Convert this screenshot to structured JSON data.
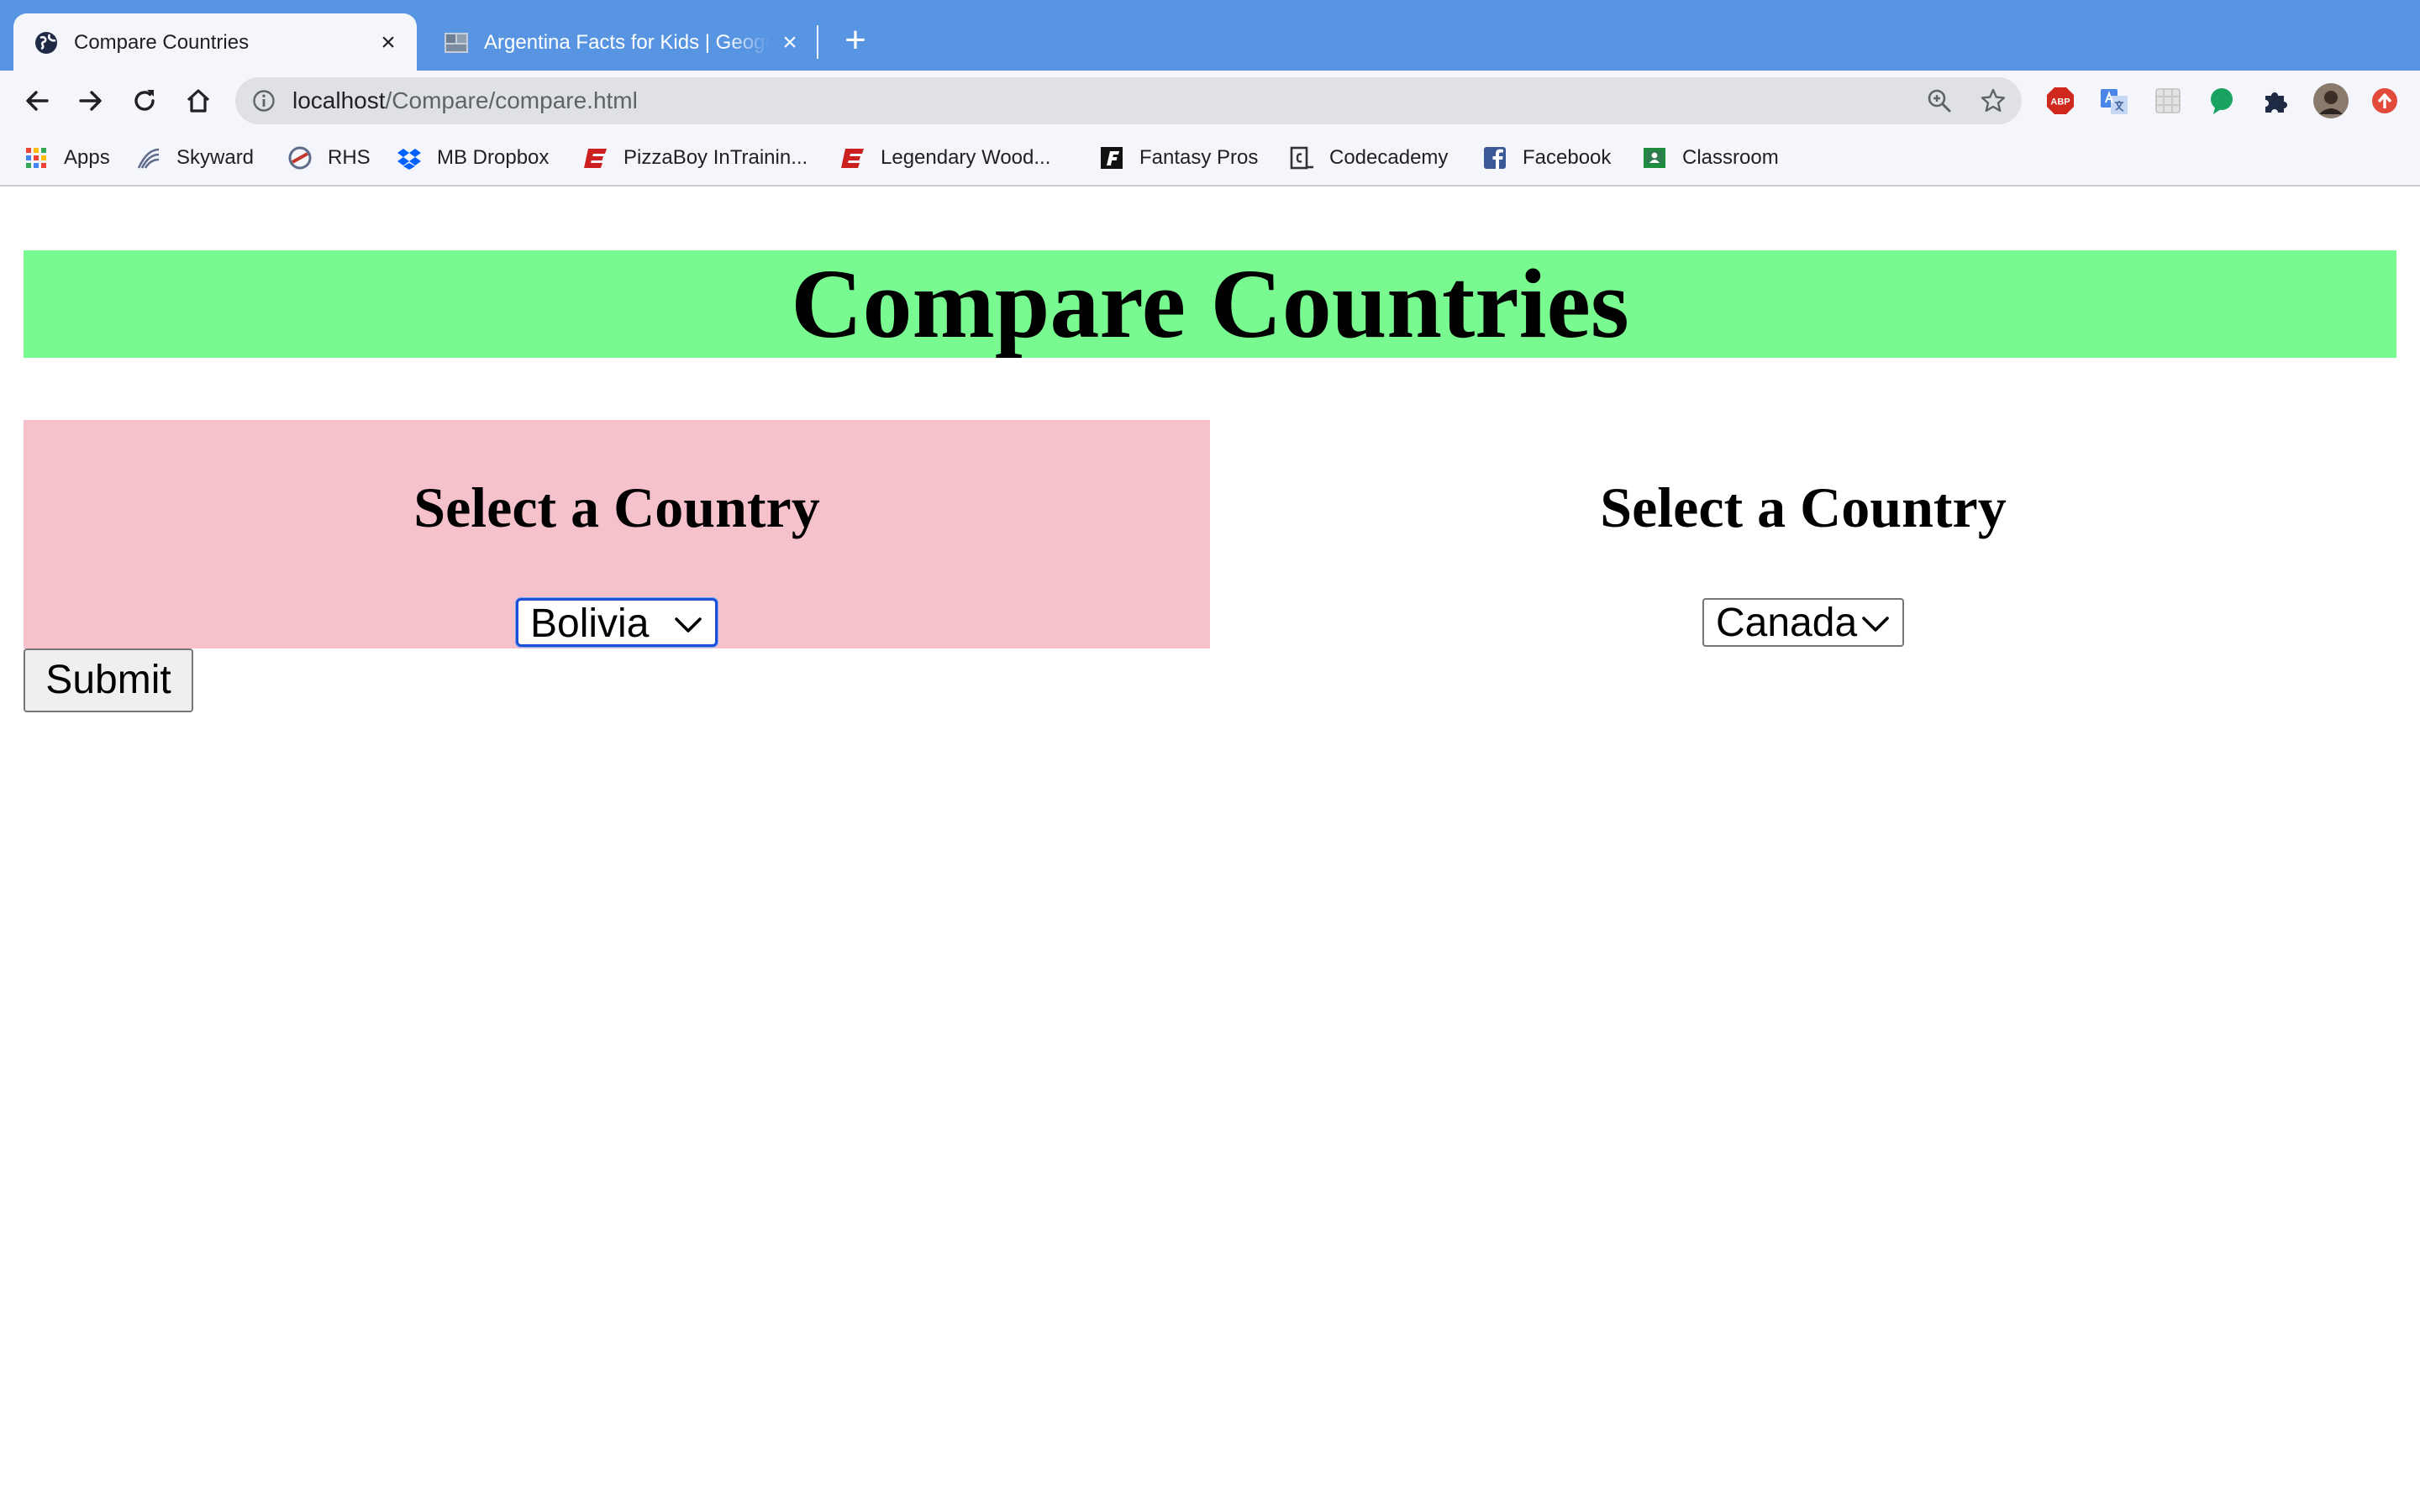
{
  "browser": {
    "tabs": [
      {
        "title": "Compare Countries",
        "icon": "globe-icon",
        "active": true
      },
      {
        "title": "Argentina Facts for Kids | Geography",
        "icon": "page-thumbnail-icon",
        "active": false
      }
    ],
    "close_glyph": "×",
    "new_tab_glyph": "+",
    "address": {
      "host": "localhost",
      "path": "/Compare/compare.html"
    },
    "bookmarks": [
      {
        "label": "Apps",
        "icon": "apps-grid-icon",
        "color": "#ea4335"
      },
      {
        "label": "Skyward",
        "icon": "skyward-icon",
        "color": "#5f6b8a"
      },
      {
        "label": "RHS",
        "icon": "rhs-icon",
        "color": "#c0392b"
      },
      {
        "label": "MB Dropbox",
        "icon": "dropbox-icon",
        "color": "#0061fe"
      },
      {
        "label": "PizzaBoy InTrainin...",
        "icon": "espn-icon",
        "color": "#cc1f1f"
      },
      {
        "label": "Legendary Wood...",
        "icon": "espn-icon",
        "color": "#cc1f1f"
      },
      {
        "label": "Fantasy Pros",
        "icon": "fantasypros-icon",
        "color": "#111111"
      },
      {
        "label": "Codecademy",
        "icon": "codecademy-icon",
        "color": "#333333"
      },
      {
        "label": "Facebook",
        "icon": "facebook-icon",
        "color": "#3b5998"
      },
      {
        "label": "Classroom",
        "icon": "classroom-icon",
        "color": "#1e8e3e"
      }
    ],
    "extensions": [
      {
        "name": "adblock-icon",
        "label": "ABP",
        "color": "#d0271f"
      },
      {
        "name": "translate-icon",
        "color": "#4a86e8"
      },
      {
        "name": "grid-extension-icon",
        "color": "#c8c8c8"
      },
      {
        "name": "chat-bubble-icon",
        "color": "#1aa260"
      },
      {
        "name": "puzzle-icon",
        "color": "#1f2a44"
      },
      {
        "name": "profile-avatar-icon",
        "color": "#6b5b4d"
      },
      {
        "name": "update-arrow-icon",
        "color": "#e24b3b"
      }
    ]
  },
  "page": {
    "heading": "Compare Countries",
    "colors": {
      "heading_bg": "#78fa90",
      "left_panel_bg": "#f5c1ca"
    },
    "panels": [
      {
        "title": "Select a Country",
        "selected": "Bolivia",
        "focused": true
      },
      {
        "title": "Select a Country",
        "selected": "Canada",
        "focused": false
      }
    ],
    "submit_label": "Submit"
  }
}
